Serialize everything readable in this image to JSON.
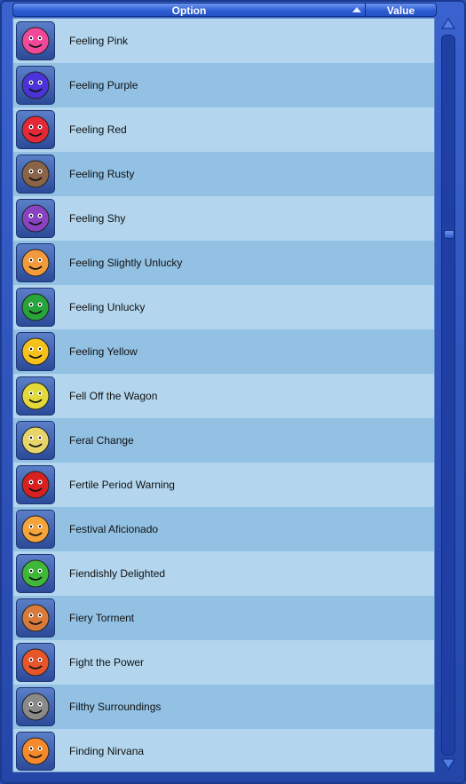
{
  "header": {
    "option_label": "Option",
    "value_label": "Value"
  },
  "colors": {
    "row_light": "#b3d6ee",
    "row_dark": "#92c1e4",
    "header_blue": "#2f5ed6",
    "frame_blue": "#2a4fb8"
  },
  "rows": [
    {
      "label": "Feeling Pink",
      "icon": "pink-face-icon",
      "color": "#f0489a"
    },
    {
      "label": "Feeling Purple",
      "icon": "purple-face-icon",
      "color": "#4a33d8"
    },
    {
      "label": "Feeling Red",
      "icon": "red-face-icon",
      "color": "#e32838"
    },
    {
      "label": "Feeling Rusty",
      "icon": "rusty-robot-face-icon",
      "color": "#8a6448"
    },
    {
      "label": "Feeling Shy",
      "icon": "shy-face-icon",
      "color": "#8a43c0"
    },
    {
      "label": "Feeling Slightly Unlucky",
      "icon": "unlucky-face-icon",
      "color": "#f29a3c"
    },
    {
      "label": "Feeling Unlucky",
      "icon": "clover-cross-icon",
      "color": "#27a43a"
    },
    {
      "label": "Feeling Yellow",
      "icon": "yellow-face-icon",
      "color": "#f5c21b"
    },
    {
      "label": "Fell Off the Wagon",
      "icon": "fallen-figure-icon",
      "color": "#e3d93a"
    },
    {
      "label": "Feral Change",
      "icon": "moon-beast-icon",
      "color": "#e7d56b"
    },
    {
      "label": "Fertile Period Warning",
      "icon": "warning-figure-icon",
      "color": "#d92020"
    },
    {
      "label": "Festival Aficionado",
      "icon": "festival-mask-icon",
      "color": "#f4a43a"
    },
    {
      "label": "Fiendishly Delighted",
      "icon": "green-fiend-face-icon",
      "color": "#3fb83a"
    },
    {
      "label": "Fiery Torment",
      "icon": "fire-figure-icon",
      "color": "#d77a3a"
    },
    {
      "label": "Fight the Power",
      "icon": "raised-fist-icon",
      "color": "#e7552b"
    },
    {
      "label": "Filthy Surroundings",
      "icon": "trash-can-icon",
      "color": "#8a8a8a"
    },
    {
      "label": "Finding Nirvana",
      "icon": "serene-face-icon",
      "color": "#f58a2c"
    }
  ]
}
